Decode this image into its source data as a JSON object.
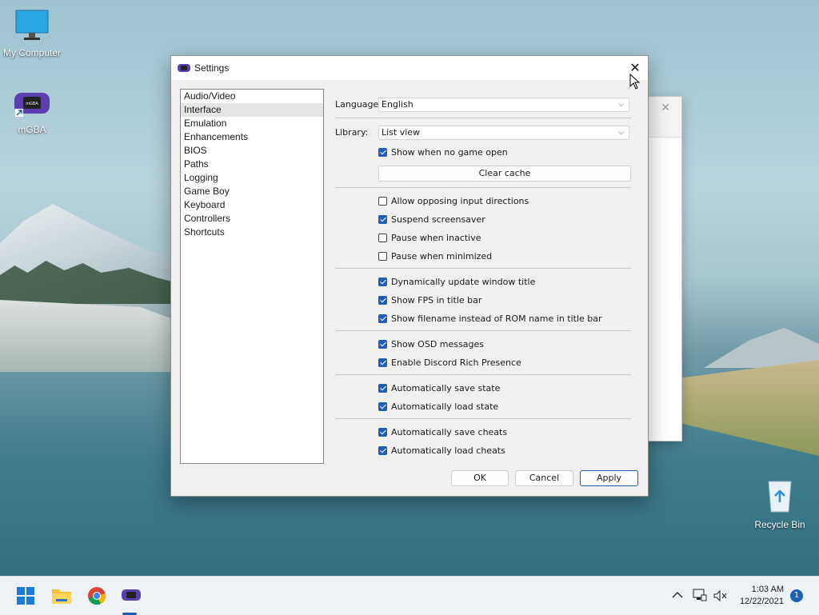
{
  "desktop": {
    "icons": [
      {
        "label": "My Computer"
      },
      {
        "label": "mGBA"
      },
      {
        "label": "Recycle Bin"
      }
    ]
  },
  "background_window": {
    "close_glyph": "✕"
  },
  "settings": {
    "title": "Settings",
    "close_glyph": "✕",
    "nav": [
      "Audio/Video",
      "Interface",
      "Emulation",
      "Enhancements",
      "BIOS",
      "Paths",
      "Logging",
      "Game Boy",
      "Keyboard",
      "Controllers",
      "Shortcuts"
    ],
    "nav_selected": "Interface",
    "language_label": "Language",
    "language_value": "English",
    "library_label": "Library:",
    "library_value": "List view",
    "show_when_no_game": "Show when no game open",
    "clear_cache": "Clear cache",
    "options": {
      "allow_opposing": "Allow opposing input directions",
      "suspend_screensaver": "Suspend screensaver",
      "pause_inactive": "Pause when inactive",
      "pause_minimized": "Pause when minimized",
      "dyn_title": "Dynamically update window title",
      "show_fps": "Show FPS in title bar",
      "show_filename": "Show filename instead of ROM name in title bar",
      "show_osd": "Show OSD messages",
      "discord": "Enable Discord Rich Presence",
      "auto_save_state": "Automatically save state",
      "auto_load_state": "Automatically load state",
      "auto_save_cheats": "Automatically save cheats",
      "auto_load_cheats": "Automatically load cheats"
    },
    "checked": {
      "show_when_no_game": true,
      "allow_opposing": false,
      "suspend_screensaver": true,
      "pause_inactive": false,
      "pause_minimized": false,
      "dyn_title": true,
      "show_fps": true,
      "show_filename": true,
      "show_osd": true,
      "discord": true,
      "auto_save_state": true,
      "auto_load_state": true,
      "auto_save_cheats": true,
      "auto_load_cheats": true
    },
    "buttons": {
      "ok": "OK",
      "cancel": "Cancel",
      "apply": "Apply"
    }
  },
  "taskbar": {
    "time": "1:03 AM",
    "date": "12/22/2021",
    "notification_count": "1",
    "icons": [
      "windows-start-icon",
      "file-explorer-icon",
      "chrome-icon",
      "mgba-icon"
    ]
  },
  "colors": {
    "accent": "#1c5fb5"
  }
}
